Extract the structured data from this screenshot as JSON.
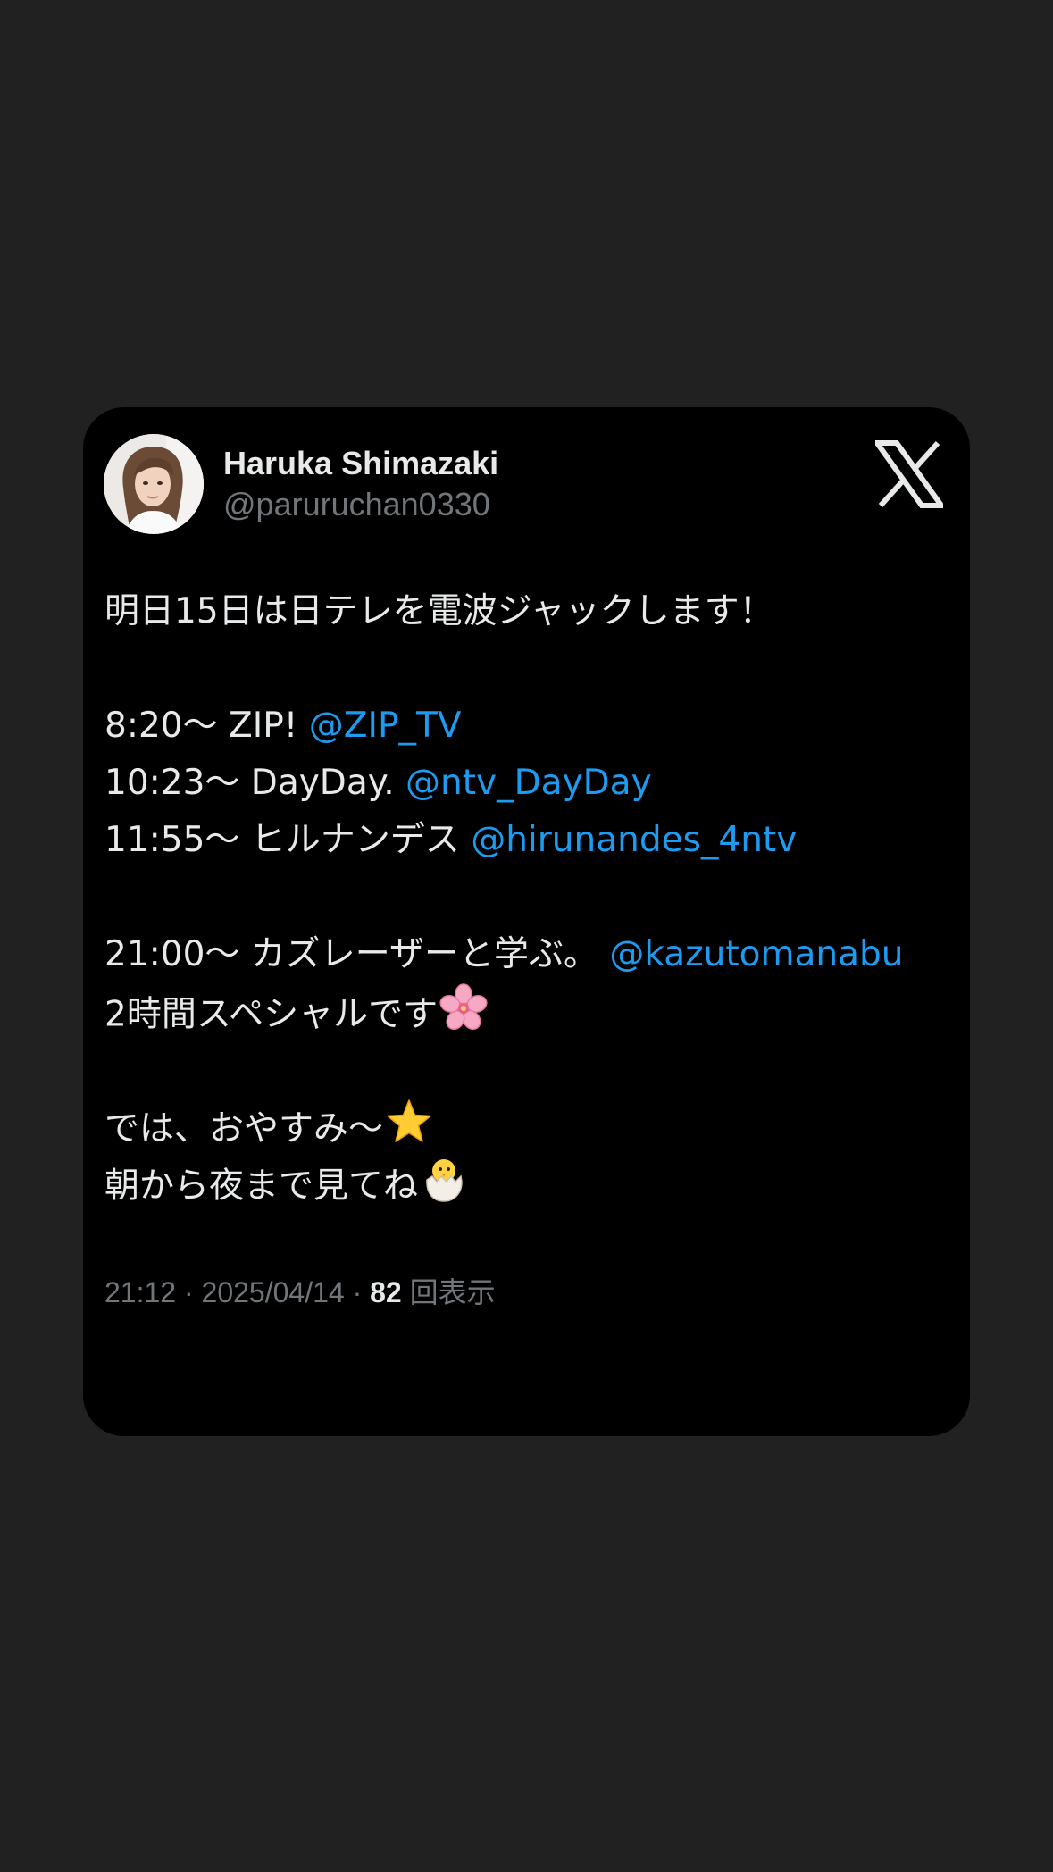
{
  "tweet": {
    "author": {
      "display_name": "Haruka Shimazaki",
      "handle": "@paruruchan0330"
    },
    "logo_icon": "x-logo-icon",
    "lines": {
      "l1": "明日15日は日テレを電波ジャックします！",
      "l2_text": "8:20〜 ZIP! ",
      "l2_mention": "@ZIP_TV",
      "l3_text": "10:23〜 DayDay. ",
      "l3_mention": "@ntv_DayDay",
      "l4_text": "11:55〜 ヒルナンデス ",
      "l4_mention": "@hirunandes_4ntv",
      "l5_text": "21:00〜 カズレーザーと学ぶ。 ",
      "l5_mention": "@kazutomanabu",
      "l6_text": "2時間スペシャルです",
      "l6_emoji": "cherry-blossom-icon",
      "l7_text": "では、おやすみ〜",
      "l7_emoji": "star-icon",
      "l8_text": "朝から夜まで見てね",
      "l8_emoji": "hatching-chick-icon"
    },
    "meta": {
      "time": "21:12",
      "sep1": " · ",
      "date": "2025/04/14",
      "sep2": " · ",
      "views_count": "82",
      "views_label": " 回表示"
    },
    "colors": {
      "background": "#212121",
      "card": "#000000",
      "text": "#e7e9ea",
      "muted": "#71767b",
      "mention": "#1d9bf0"
    }
  }
}
